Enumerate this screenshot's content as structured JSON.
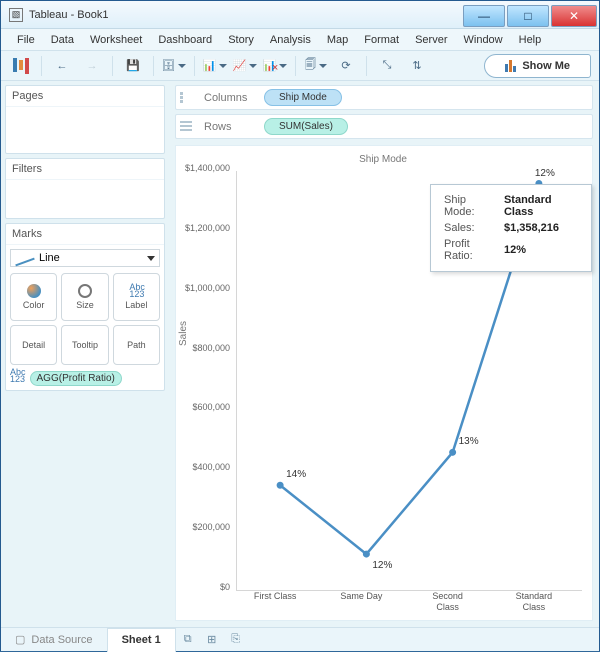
{
  "window": {
    "title": "Tableau - Book1"
  },
  "menu": [
    "File",
    "Data",
    "Worksheet",
    "Dashboard",
    "Story",
    "Analysis",
    "Map",
    "Format",
    "Server",
    "Window",
    "Help"
  ],
  "toolbar": {
    "showme": "Show Me"
  },
  "sidebar": {
    "pages": "Pages",
    "filters": "Filters",
    "marks": "Marks",
    "marks_type": "Line",
    "cards": {
      "color": "Color",
      "size": "Size",
      "label": "Label",
      "detail": "Detail",
      "tooltip": "Tooltip",
      "path": "Path"
    },
    "agg_pill": "AGG(Profit Ratio)"
  },
  "shelves": {
    "columns_label": "Columns",
    "columns_pill": "Ship Mode",
    "rows_label": "Rows",
    "rows_pill": "SUM(Sales)"
  },
  "chart_data": {
    "type": "line",
    "title": "Ship Mode",
    "ylabel": "Sales",
    "ylim": [
      0,
      1400000
    ],
    "yticks_labels": [
      "$0",
      "$200,000",
      "$400,000",
      "$600,000",
      "$800,000",
      "$1,000,000",
      "$1,200,000",
      "$1,400,000"
    ],
    "yticks_values": [
      0,
      200000,
      400000,
      600000,
      800000,
      1000000,
      1200000,
      1400000
    ],
    "categories": [
      "First Class",
      "Same Day",
      "Second Class",
      "Standard Class"
    ],
    "category_labels": [
      "First Class",
      "Same Day",
      "Second\nClass",
      "Standard\nClass"
    ],
    "values": [
      350000,
      120000,
      460000,
      1358216
    ],
    "point_labels": [
      "14%",
      "12%",
      "13%",
      "12%"
    ]
  },
  "tooltip": {
    "rows": [
      {
        "k": "Ship Mode:",
        "v": "Standard Class"
      },
      {
        "k": "Sales:",
        "v": "$1,358,216"
      },
      {
        "k": "Profit Ratio:",
        "v": "12%"
      }
    ]
  },
  "footer": {
    "datasource": "Data Source",
    "tab": "Sheet 1"
  }
}
